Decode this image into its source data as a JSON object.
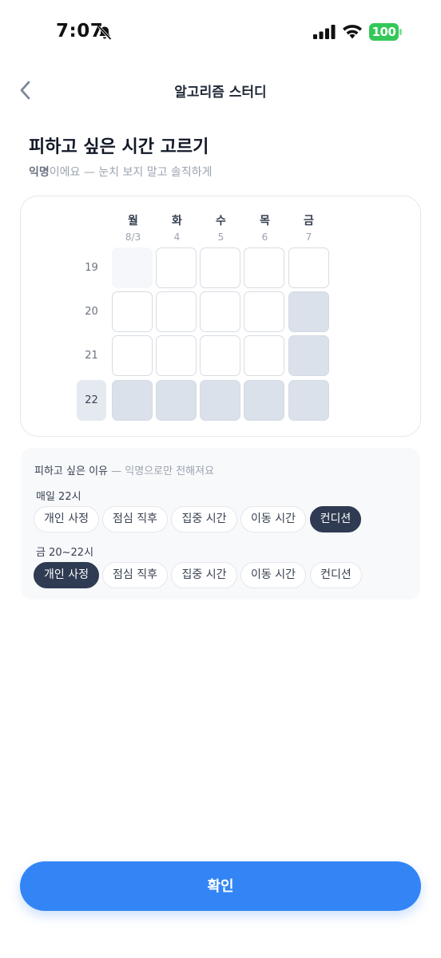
{
  "status": {
    "time": "7:07",
    "battery": "100"
  },
  "nav": {
    "title": "알고리즘 스터디"
  },
  "header": {
    "title": "피하고 싶은 시간 고르기",
    "subtitle_bold": "익명",
    "subtitle_rest": "이에요 — 눈치 보지 말고 솔직하게"
  },
  "grid": {
    "days": [
      {
        "name": "월",
        "date": "8/3"
      },
      {
        "name": "화",
        "date": "4"
      },
      {
        "name": "수",
        "date": "5"
      },
      {
        "name": "목",
        "date": "6"
      },
      {
        "name": "금",
        "date": "7"
      }
    ],
    "hours": [
      "19",
      "20",
      "21",
      "22"
    ]
  },
  "reasons": {
    "title": "피하고 싶은 이유",
    "title_note": " — 익명으로만 전해져요",
    "groups": [
      {
        "label": "매일 22시",
        "chips": [
          "개인 사정",
          "점심 직후",
          "집중 시간",
          "이동 시간",
          "컨디션"
        ],
        "selected": 4
      },
      {
        "label": "금 20~22시",
        "chips": [
          "개인 사정",
          "점심 직후",
          "집중 시간",
          "이동 시간",
          "컨디션"
        ],
        "selected": 0
      }
    ]
  },
  "confirm": {
    "label": "확인"
  },
  "colors": {
    "accent": "#3385f5",
    "chip_selected": "#2f3b52",
    "cell_selected": "#dbe1ea",
    "battery": "#34c759"
  }
}
